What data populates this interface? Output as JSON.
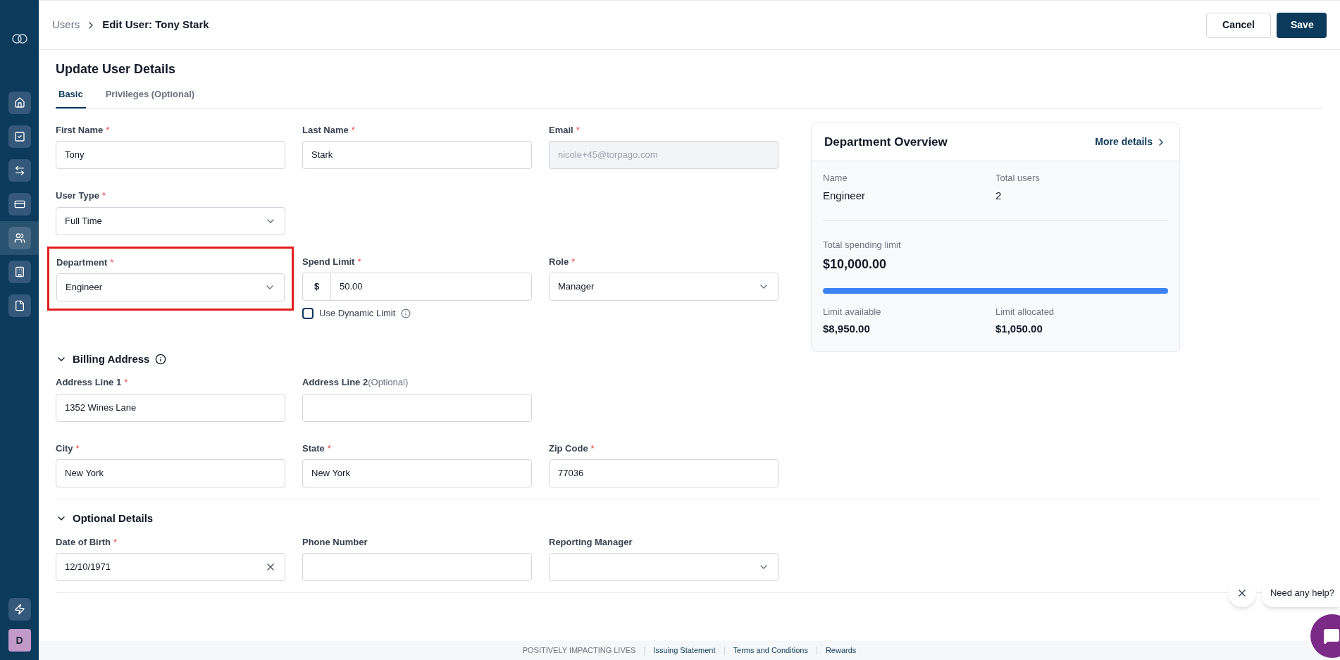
{
  "sidebar": {
    "items": [
      {
        "selected": false
      },
      {
        "selected": false
      },
      {
        "selected": false
      },
      {
        "selected": false
      },
      {
        "selected": true
      },
      {
        "selected": false
      },
      {
        "selected": false
      }
    ],
    "avatar": "D"
  },
  "header": {
    "breadcrumb": "Users",
    "current": "Edit User: Tony Stark",
    "buttons": [
      {
        "label": "Cancel",
        "kind": "secondary"
      },
      {
        "label": "Save",
        "kind": "primary"
      }
    ]
  },
  "form_title": "Update User Details",
  "tabs": [
    {
      "label": "Basic",
      "selected": true
    },
    {
      "label": "Privileges (Optional)",
      "selected": false
    }
  ],
  "basic_rows": [
    [
      {
        "kind": "text",
        "label": "First Name",
        "required_mark": "*",
        "value": "Tony",
        "disabled": false,
        "highlighted": false
      },
      {
        "kind": "text",
        "label": "Last Name",
        "required_mark": "*",
        "value": "Stark",
        "disabled": false,
        "highlighted": false
      },
      {
        "kind": "text",
        "label": "Email",
        "required_mark": "*",
        "value": "nicole+45@torpago.com",
        "disabled": true,
        "highlighted": false
      }
    ],
    [
      {
        "kind": "select",
        "label": "User Type",
        "required_mark": "*",
        "value": "Full Time",
        "disabled": false,
        "highlighted": false
      }
    ],
    [
      {
        "kind": "select",
        "label": "Department",
        "required_mark": "*",
        "value": "Engineer",
        "disabled": false,
        "highlighted": true
      },
      {
        "kind": "money",
        "label": "Spend Limit",
        "required_mark": "*",
        "currency": "$",
        "value": "50.00",
        "disabled": false,
        "highlighted": false,
        "checkbox": {
          "label": "Use Dynamic Limit",
          "checked": false
        }
      },
      {
        "kind": "select",
        "label": "Role",
        "required_mark": "*",
        "value": "Manager",
        "disabled": false,
        "highlighted": false
      }
    ]
  ],
  "sections": [
    {
      "title": "Billing Address",
      "expanded": true,
      "info": true,
      "rows": [
        [
          {
            "kind": "text",
            "label": "Address Line 1",
            "required_mark": "*",
            "value": "1352 Wines Lane",
            "disabled": false,
            "highlighted": false
          },
          {
            "kind": "text",
            "label": "Address Line 2",
            "note": "(Optional)",
            "disabled": false,
            "highlighted": false
          }
        ],
        [
          {
            "kind": "text",
            "label": "City",
            "required_mark": "*",
            "value": "New York",
            "disabled": false,
            "highlighted": false
          },
          {
            "kind": "text",
            "label": "State",
            "required_mark": "*",
            "value": "New York",
            "disabled": false,
            "highlighted": false
          },
          {
            "kind": "text",
            "label": "Zip Code",
            "required_mark": "*",
            "value": "77036",
            "disabled": false,
            "highlighted": false
          }
        ]
      ]
    },
    {
      "title": "Optional Details",
      "expanded": true,
      "info": false,
      "rows": [
        [
          {
            "kind": "date",
            "label": "Date of Birth",
            "required_mark": "*",
            "value": "12/10/1971",
            "disabled": false,
            "highlighted": false
          },
          {
            "kind": "text",
            "label": "Phone Number",
            "disabled": false,
            "highlighted": false
          },
          {
            "kind": "select",
            "label": "Reporting Manager",
            "disabled": false,
            "highlighted": false
          }
        ]
      ]
    }
  ],
  "department_card": {
    "title": "Department Overview",
    "link": "More details",
    "name_label": "Name",
    "name": "Engineer",
    "users_label": "Total users",
    "users": "2",
    "limit_label": "Total spending limit",
    "limit": "$10,000.00",
    "level": 1,
    "available_label": "Limit available",
    "available": "$8,950.00",
    "allocated_label": "Limit allocated",
    "allocated": "$1,050.00"
  },
  "footer": [
    {
      "label": "POSITIVELY IMPACTING LIVES",
      "kind": "text"
    },
    {
      "label": "Issuing Statement",
      "kind": "link"
    },
    {
      "label": "Terms and Conditions",
      "kind": "link"
    },
    {
      "label": "Rewards",
      "kind": "link"
    }
  ],
  "help": {
    "message": "Need any help?"
  }
}
